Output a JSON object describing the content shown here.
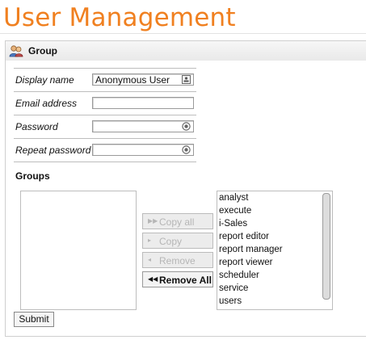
{
  "page": {
    "title": "User Management"
  },
  "panel": {
    "title": "Group",
    "icon": "users-group-icon"
  },
  "form": {
    "display_name_label": "Display name",
    "display_name_value": "Anonymous User",
    "email_label": "Email address",
    "email_value": "",
    "password_label": "Password",
    "password_value": "",
    "repeat_password_label": "Repeat password",
    "repeat_password_value": ""
  },
  "groups": {
    "heading": "Groups",
    "selected": [],
    "available": [
      "analyst",
      "execute",
      "i-Sales",
      "report editor",
      "report manager",
      "report viewer",
      "scheduler",
      "service",
      "users"
    ],
    "buttons": {
      "copy_all": "Copy all",
      "copy": "Copy",
      "remove": "Remove",
      "remove_all": "Remove All"
    }
  },
  "submit_label": "Submit"
}
